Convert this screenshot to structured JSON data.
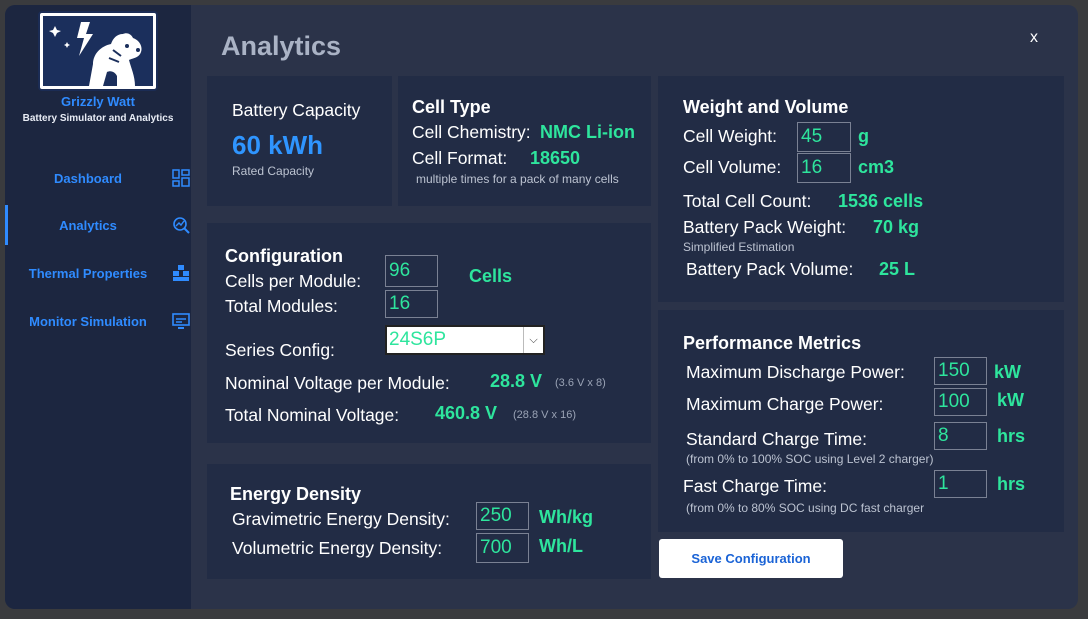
{
  "app": {
    "name": "Grizzly Watt",
    "subtitle": "Battery Simulator and Analytics",
    "close": "x"
  },
  "nav": [
    {
      "label": "Dashboard",
      "icon": "dashboard-grid-icon"
    },
    {
      "label": "Analytics",
      "icon": "analytics-icon",
      "active": true
    },
    {
      "label": "Thermal Properties",
      "icon": "thermal-icon"
    },
    {
      "label": "Monitor Simulation",
      "icon": "monitor-icon"
    }
  ],
  "page": {
    "title": "Analytics"
  },
  "capacity": {
    "label": "Battery Capacity",
    "value": "60 kWh",
    "note": "Rated Capacity"
  },
  "cell_type": {
    "heading": "Cell Type",
    "chem_label": "Cell Chemistry:",
    "chem_value": "NMC Li-ion",
    "format_label": "Cell Format:",
    "format_value": "18650",
    "note": "multiple times for a pack of many cells"
  },
  "weight": {
    "heading": "Weight and Volume",
    "cell_weight_label": "Cell Weight:",
    "cell_weight_value": "45",
    "cell_weight_unit": "g",
    "cell_volume_label": "Cell Volume:",
    "cell_volume_value": "16",
    "cell_volume_unit": "cm3",
    "count_label": "Total Cell Count:",
    "count_value": "1536 cells",
    "pack_weight_label": "Battery Pack Weight:",
    "pack_weight_value": "70 kg",
    "pack_weight_note": "Simplified Estimation",
    "pack_volume_label": "Battery Pack Volume:",
    "pack_volume_value": "25 L"
  },
  "config": {
    "heading": "Configuration",
    "cells_label": "Cells per Module:",
    "cells_value": "96",
    "cells_unit": "Cells",
    "modules_label": "Total Modules:",
    "modules_value": "16",
    "series_label": "Series Config:",
    "series_value": "24S6P",
    "nom_module_label": "Nominal Voltage per Module:",
    "nom_module_value": "28.8 V",
    "nom_module_note": "(3.6 V x 8)",
    "total_label": "Total Nominal Voltage:",
    "total_value": "460.8 V",
    "total_note": "(28.8 V x 16)"
  },
  "performance": {
    "heading": "Performance Metrics",
    "discharge_label": "Maximum Discharge Power:",
    "discharge_value": "150",
    "discharge_unit": "kW",
    "charge_label": "Maximum Charge Power:",
    "charge_value": "100",
    "charge_unit": "kW",
    "std_label": "Standard Charge Time:",
    "std_value": "8",
    "std_unit": "hrs",
    "std_note": "(from 0% to 100% SOC using Level 2 charger)",
    "fast_label": "Fast Charge Time:",
    "fast_value": "1",
    "fast_unit": "hrs",
    "fast_note": "(from 0% to 80% SOC using DC fast charger"
  },
  "energy": {
    "heading": "Energy Density",
    "grav_label": "Gravimetric Energy Density:",
    "grav_value": "250",
    "grav_unit": "Wh/kg",
    "vol_label": "Volumetric Energy Density:",
    "vol_value": "700",
    "vol_unit": "Wh/L"
  },
  "actions": {
    "save": "Save Configuration"
  },
  "colors": {
    "accent": "#2f8bff",
    "value_green": "#2ee59d",
    "panel": "#222c45",
    "window": "#2b3349",
    "sidebar": "#1c2640"
  }
}
